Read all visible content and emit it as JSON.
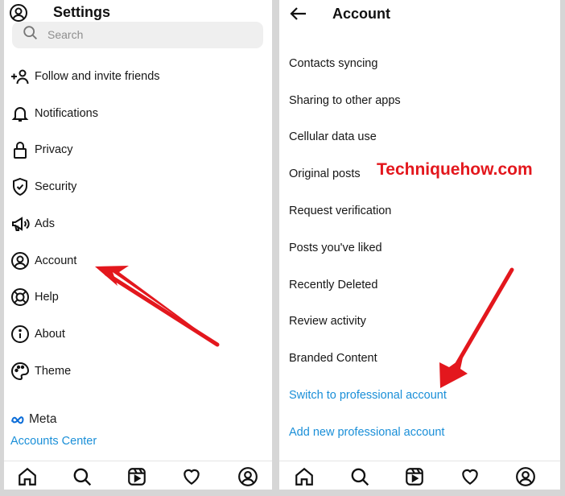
{
  "left": {
    "title": "Settings",
    "search_placeholder": "Search",
    "items": [
      {
        "label": "Follow and invite friends",
        "icon": "add-person-icon"
      },
      {
        "label": "Notifications",
        "icon": "bell-icon"
      },
      {
        "label": "Privacy",
        "icon": "lock-icon"
      },
      {
        "label": "Security",
        "icon": "shield-icon"
      },
      {
        "label": "Ads",
        "icon": "megaphone-icon"
      },
      {
        "label": "Account",
        "icon": "account-circle-icon"
      },
      {
        "label": "Help",
        "icon": "lifebuoy-icon"
      },
      {
        "label": "About",
        "icon": "info-icon"
      },
      {
        "label": "Theme",
        "icon": "palette-icon"
      }
    ],
    "meta_label": "Meta",
    "accounts_center": "Accounts Center"
  },
  "right": {
    "title": "Account",
    "items": [
      {
        "label": "Contacts syncing"
      },
      {
        "label": "Sharing to other apps"
      },
      {
        "label": "Cellular data use"
      },
      {
        "label": "Original posts"
      },
      {
        "label": "Request verification"
      },
      {
        "label": "Posts you've liked"
      },
      {
        "label": "Recently Deleted"
      },
      {
        "label": "Review activity"
      },
      {
        "label": "Branded Content"
      }
    ],
    "links": [
      {
        "label": "Switch to professional account"
      },
      {
        "label": "Add new professional account"
      }
    ]
  },
  "watermark": "Techniquehow.com",
  "colors": {
    "link": "#1a8fd8",
    "arrow": "#e3171d",
    "background": "#d6d6d6"
  },
  "tabbar_icons": [
    "home-icon",
    "search-icon",
    "reels-icon",
    "heart-icon",
    "profile-icon"
  ]
}
